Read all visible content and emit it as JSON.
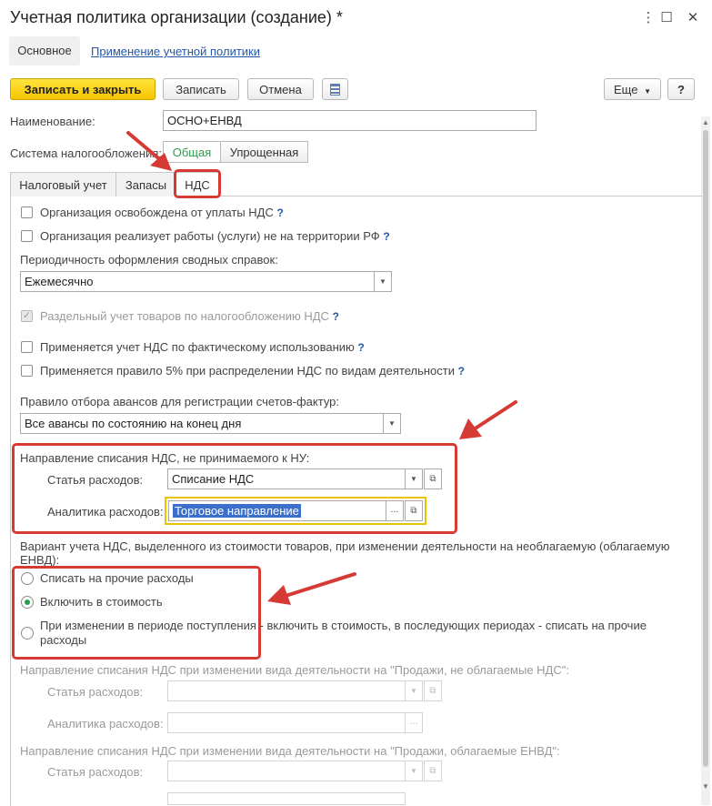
{
  "window": {
    "title": "Учетная политика организации (создание) *",
    "more_icon": "more-vertical-icon",
    "maximize_icon": "maximize-icon",
    "close_icon": "close-icon"
  },
  "topnav": {
    "main": "Основное",
    "link": "Применение учетной политики"
  },
  "toolbar": {
    "save_close": "Записать и закрыть",
    "save": "Записать",
    "cancel": "Отмена",
    "more": "Еще",
    "help": "?"
  },
  "name": {
    "label": "Наименование:",
    "value": "ОСНО+ЕНВД"
  },
  "tax_system": {
    "label": "Система налогообложения:",
    "options": [
      "Общая",
      "Упрощенная"
    ],
    "selected": "Общая"
  },
  "tabs": [
    "Налоговый учет",
    "Запасы",
    "НДС"
  ],
  "active_tab": "НДС",
  "vat": {
    "exempt": "Организация освобождена от уплаты НДС",
    "abroad": "Организация реализует работы (услуги) не на территории РФ",
    "period_label": "Периодичность оформления сводных справок:",
    "period_value": "Ежемесячно",
    "separate": "Раздельный учет товаров по налогообложению НДС",
    "actual_use": "Применяется учет НДС по фактическому использованию",
    "rule5": "Применяется правило 5% при распределении НДС по видам деятельности",
    "advance_label": "Правило отбора авансов для регистрации счетов-фактур:",
    "advance_value": "Все авансы по состоянию на конец дня",
    "direction_label": "Направление списания НДС, не принимаемого к НУ:",
    "expense_item_label": "Статья расходов:",
    "expense_item_value": "Списание НДС",
    "analytics_label": "Аналитика расходов:",
    "analytics_value": "Торговое направление",
    "variant_label": "Вариант учета НДС, выделенного из стоимости товаров, при изменении деятельности на необлагаемую (облагаемую ЕНВД):",
    "radio1": "Списать на прочие расходы",
    "radio2": "Включить в стоимость",
    "radio3": "При изменении в периоде поступления - включить в стоимость, в последующих периодах - списать на прочие расходы",
    "radio_selected": 2,
    "dir_nonvat_label": "Направление списания НДС при изменении вида деятельности на \"Продажи, не облагаемые НДС\":",
    "dir_envd_label": "Направление списания НДС при изменении вида деятельности на \"Продажи, облагаемые ЕНВД\":",
    "ellipsis": "..."
  }
}
